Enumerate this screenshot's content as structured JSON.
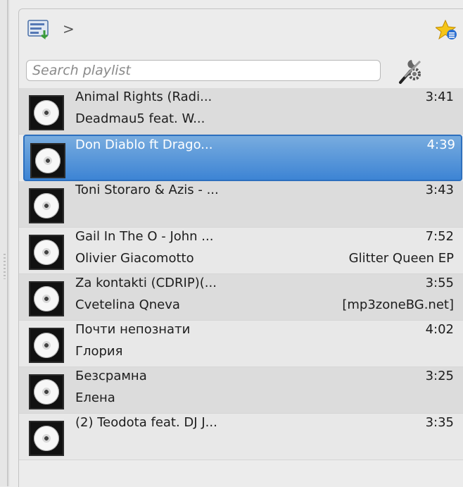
{
  "toolbar": {
    "breadcrumb_separator": ">",
    "icons": {
      "playlist": "playlist-icon",
      "favorite": "star-favorite-icon",
      "tools": "tools-icon"
    }
  },
  "search": {
    "placeholder": "Search playlist",
    "value": ""
  },
  "playlist": [
    {
      "title": "Animal Rights (Radi...",
      "subtitle": "Deadmau5  feat. W...",
      "duration": "3:41",
      "extra": ""
    },
    {
      "title": "Don Diablo ft Drago...",
      "subtitle": "",
      "duration": "4:39",
      "extra": "",
      "selected": true
    },
    {
      "title": "Toni Storaro & Azis - ...",
      "subtitle": "",
      "duration": "3:43",
      "extra": ""
    },
    {
      "title": "Gail In The O - John ...",
      "subtitle": "Olivier Giacomotto",
      "duration": "7:52",
      "extra": "Glitter Queen EP"
    },
    {
      "title": "Za kontakti (CDRIP)(...",
      "subtitle": "Cvetelina Qneva",
      "duration": "3:55",
      "extra": "[mp3zoneBG.net]"
    },
    {
      "title": "Почти непознати",
      "subtitle": "Глория",
      "duration": "4:02",
      "extra": ""
    },
    {
      "title": "Безсрамна",
      "subtitle": "Елена",
      "duration": "3:25",
      "extra": ""
    },
    {
      "title": "(2) Teodota feat. DJ J...",
      "subtitle": "",
      "duration": "3:35",
      "extra": ""
    }
  ],
  "colors": {
    "selection": "#3d84d4",
    "background": "#ececec"
  }
}
